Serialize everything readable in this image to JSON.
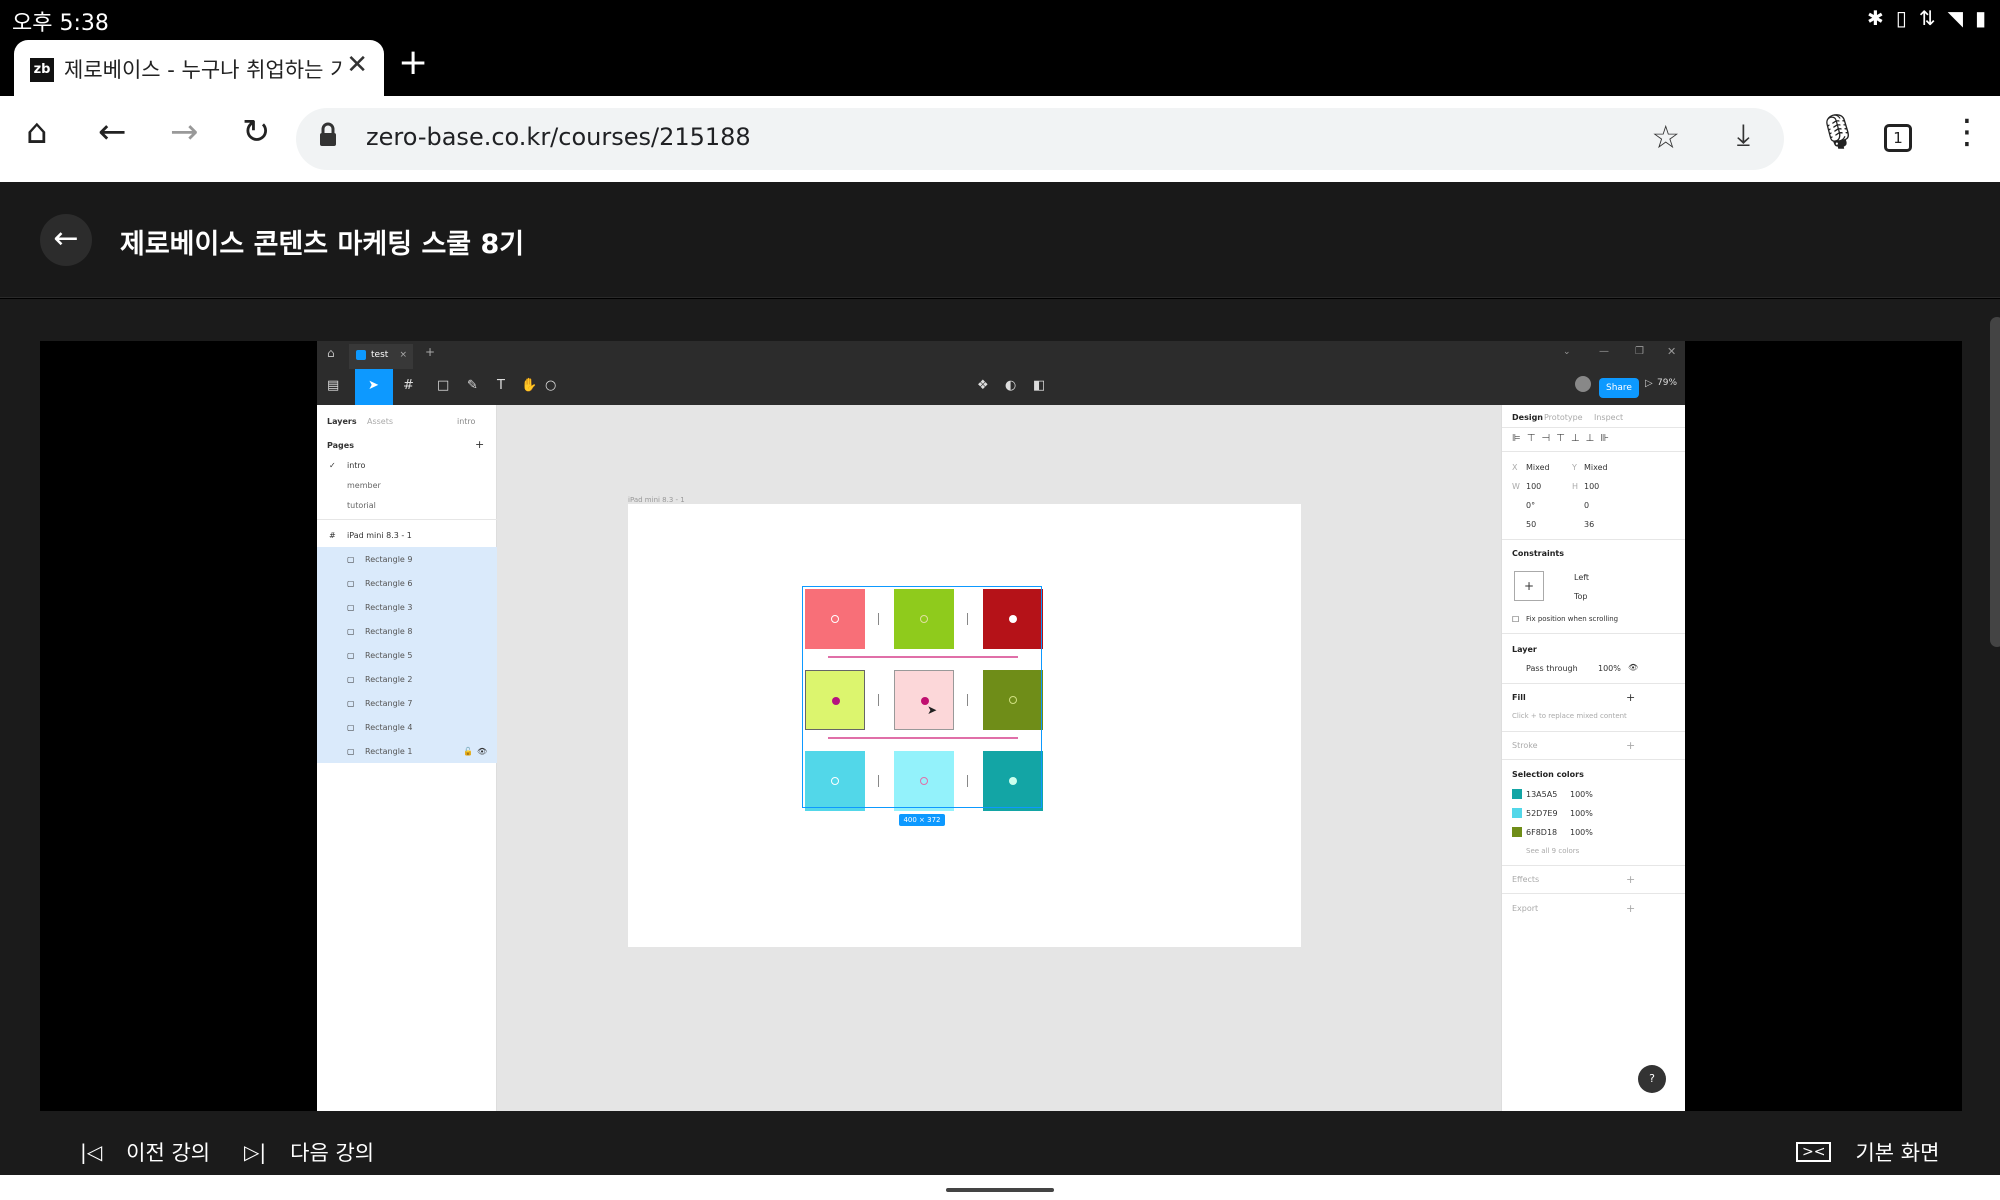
{
  "status_bar": {
    "time": "오후 5:38"
  },
  "browser": {
    "tab_title": "제로베이스 - 누구나 취업하는 기",
    "tab_favicon": "zb",
    "url": "zero-base.co.kr/courses/215188",
    "tab_count": "1"
  },
  "course": {
    "title": "제로베이스 콘텐츠 마케팅 스쿨 8기"
  },
  "figma": {
    "file_tab": "test",
    "share_label": "Share",
    "zoom": "79%",
    "left_panel": {
      "tabs": [
        "Layers",
        "Assets"
      ],
      "page_selector": "intro",
      "pages_header": "Pages",
      "pages": [
        "intro",
        "member",
        "tutorial"
      ],
      "frame_name": "iPad mini 8.3 - 1",
      "layers": [
        "Rectangle 9",
        "Rectangle 6",
        "Rectangle 3",
        "Rectangle 8",
        "Rectangle 5",
        "Rectangle 2",
        "Rectangle 7",
        "Rectangle 4",
        "Rectangle 1"
      ]
    },
    "canvas": {
      "frame_label": "iPad mini 8.3 - 1",
      "selection_size": "400 × 372",
      "rect_colors": [
        "#f86f78",
        "#8fcb1c",
        "#b51218",
        "#dcf56e",
        "#fcd7d9",
        "#6f8d18",
        "#52d7e9",
        "#93f2fb",
        "#13a5a5"
      ]
    },
    "right_panel": {
      "tabs": [
        "Design",
        "Prototype",
        "Inspect"
      ],
      "x_label": "X",
      "x_value": "Mixed",
      "y_label": "Y",
      "y_value": "Mixed",
      "w_label": "W",
      "w_value": "100",
      "h_label": "H",
      "h_value": "100",
      "rotation": "0°",
      "radius": "0",
      "spacing_a": "50",
      "spacing_b": "36",
      "constraints_header": "Constraints",
      "constraint_h": "Left",
      "constraint_v": "Top",
      "fix_position": "Fix position when scrolling",
      "layer_header": "Layer",
      "blend_mode": "Pass through",
      "opacity": "100%",
      "fill_header": "Fill",
      "fill_hint": "Click + to replace mixed content",
      "stroke_header": "Stroke",
      "selection_colors_header": "Selection colors",
      "selection_colors": [
        {
          "hex": "13A5A5",
          "opacity": "100%",
          "color": "#13a5a5"
        },
        {
          "hex": "52D7E9",
          "opacity": "100%",
          "color": "#52d7e9"
        },
        {
          "hex": "6F8D18",
          "opacity": "100%",
          "color": "#6f8d18"
        }
      ],
      "see_all": "See all 9 colors",
      "effects_header": "Effects",
      "export_header": "Export",
      "help": "?"
    }
  },
  "player_nav": {
    "prev_label": "이전 강의",
    "next_label": "다음 강의",
    "view_label": "기본 화면"
  }
}
